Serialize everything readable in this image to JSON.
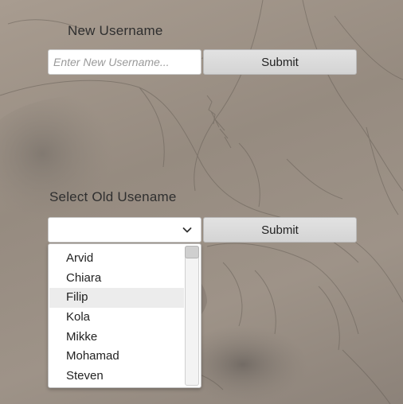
{
  "new_username": {
    "label": "New Username",
    "input_placeholder": "Enter New Username...",
    "input_value": "",
    "submit_label": "Submit"
  },
  "old_username": {
    "label": "Select Old Usename",
    "selected_value": "",
    "submit_label": "Submit",
    "dropdown_icon": "chevron-down-icon",
    "options": [
      "Arvid",
      "Chiara",
      "Filip",
      "Kola",
      "Mikke",
      "Mohamad",
      "Steven"
    ],
    "highlighted_option": "Filip"
  },
  "colors": {
    "background": "#9e9388",
    "button": "#d8d8d8",
    "highlight": "#ececec",
    "text": "#2f2f2f"
  }
}
